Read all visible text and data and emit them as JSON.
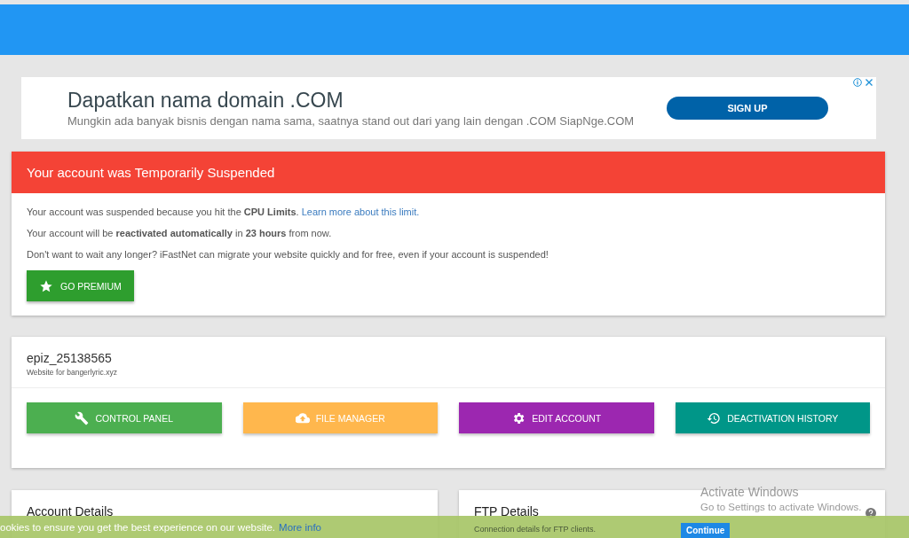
{
  "ad": {
    "title": "Dapatkan nama domain .COM",
    "text": "Mungkin ada banyak bisnis dengan nama sama, saatnya stand out dari yang lain dengan .COM SiapNge.COM",
    "button": "SIGN UP"
  },
  "alert": {
    "title": "Your account was Temporarily Suspended",
    "lines": [
      {
        "text": "Your account was suspended because you hit the **CPU Limits**. ",
        "link": "Learn more about this limit."
      },
      {
        "text": "Your account will be **reactivated automatically** in **23 hours** from now."
      },
      {
        "text": "Don't want to wait any longer? iFastNet can migrate your website quickly and for free, even if your account is suspended!"
      }
    ],
    "button": "GO PREMIUM"
  },
  "account": {
    "username": "epiz_25138565",
    "subtitle": "Website for bangerlyric.xyz",
    "buttons": [
      {
        "label": "CONTROL PANEL",
        "kind": "wrench",
        "color": "#4caf50"
      },
      {
        "label": "FILE MANAGER",
        "kind": "upload",
        "color": "#ffb74d"
      },
      {
        "label": "EDIT ACCOUNT",
        "kind": "gear",
        "color": "#9c27b0"
      },
      {
        "label": "DEACTIVATION HISTORY",
        "kind": "history",
        "color": "#009688"
      }
    ]
  },
  "panels": [
    {
      "title": "Account Details"
    },
    {
      "title": "FTP Details",
      "subtitle": "Connection details for FTP clients."
    }
  ],
  "cookie_bar": {
    "text": "ookies to ensure you get the best experience on our website.",
    "link": "More info",
    "button": "Continue"
  },
  "os_notice": {
    "title": "Activate Windows",
    "text": "Go to Settings to activate Windows."
  }
}
